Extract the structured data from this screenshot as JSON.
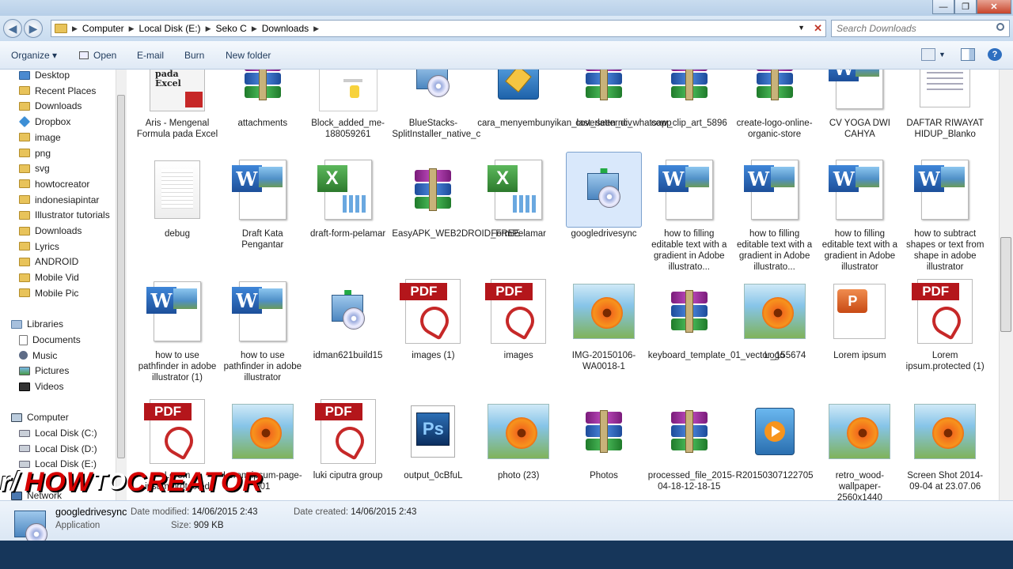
{
  "window": {
    "minimize": "—",
    "maximize": "❐",
    "close": "✕"
  },
  "address": {
    "crumbs": [
      "Computer",
      "Local Disk (E:)",
      "Seko C",
      "Downloads"
    ],
    "search_placeholder": "Search Downloads"
  },
  "toolbar": {
    "organize": "Organize ▾",
    "open": "Open",
    "email": "E-mail",
    "burn": "Burn",
    "new_folder": "New folder"
  },
  "sidebar": {
    "items": [
      "Desktop",
      "Recent Places",
      "Downloads",
      "Dropbox",
      "image",
      "png",
      "svg",
      "howtocreator",
      "indonesiapintar",
      "Illustrator tutorials",
      "Downloads",
      "Lyrics",
      "ANDROID",
      "Mobile Vid",
      "Mobile Pic"
    ],
    "libraries": "Libraries",
    "library_items": [
      "Documents",
      "Music",
      "Pictures",
      "Videos"
    ],
    "computer": "Computer",
    "drives": [
      "Local Disk (C:)",
      "Local Disk (D:)",
      "Local Disk (E:)"
    ],
    "network": "Network"
  },
  "files": [
    {
      "name": "Aris - Mengenal Formula pada Excel",
      "icon": "book-pdf-thumbnail",
      "thumb_text": "Mengenal Formula pada Excel"
    },
    {
      "name": "attachments",
      "icon": "winrar-archive"
    },
    {
      "name": "Block_added_me-188059261",
      "icon": "image-thumbnail"
    },
    {
      "name": "BlueStacks-SplitInstaller_native_c",
      "icon": "setup-installer"
    },
    {
      "name": "cara_menyembunyikan_last_seen_di_whatsapp",
      "icon": "plugin-file"
    },
    {
      "name": "coverlatterncv",
      "icon": "winrar-archive"
    },
    {
      "name": "cow_clip_art_5896",
      "icon": "winrar-archive"
    },
    {
      "name": "create-logo-online-organic-store",
      "icon": "winrar-archive"
    },
    {
      "name": "CV YOGA DWI CAHYA",
      "icon": "word-document"
    },
    {
      "name": "DAFTAR RIWAYAT HIDUP_Blanko",
      "icon": "document-list"
    },
    {
      "name": "debug",
      "icon": "blank-text-file"
    },
    {
      "name": "Draft Kata Pengantar",
      "icon": "word-document"
    },
    {
      "name": "draft-form-pelamar",
      "icon": "excel-spreadsheet"
    },
    {
      "name": "EasyAPK_WEB2DROID_FREE",
      "icon": "winrar-archive"
    },
    {
      "name": "FormPelamar",
      "icon": "excel-spreadsheet"
    },
    {
      "name": "googledrivesync",
      "icon": "setup-installer",
      "selected": true
    },
    {
      "name": "how to filling editable text with a gradient in Adobe illustrato...",
      "icon": "word-document"
    },
    {
      "name": "how to filling editable text with a gradient in Adobe illustrato...",
      "icon": "word-document"
    },
    {
      "name": "how to filling editable text with a gradient in Adobe illustrator",
      "icon": "word-document"
    },
    {
      "name": "how to subtract shapes or text from shape in adobe illustrator",
      "icon": "word-document"
    },
    {
      "name": "how to use pathfinder in adobe illustrator (1)",
      "icon": "word-document"
    },
    {
      "name": "how to use pathfinder in adobe illustrator",
      "icon": "word-document"
    },
    {
      "name": "idman621build15",
      "icon": "setup-installer"
    },
    {
      "name": "images (1)",
      "icon": "pdf-document"
    },
    {
      "name": "images",
      "icon": "pdf-document"
    },
    {
      "name": "IMG-20150106-WA0018-1",
      "icon": "flower-image"
    },
    {
      "name": "keyboard_template_01_vector_155674",
      "icon": "winrar-archive"
    },
    {
      "name": "Logo",
      "icon": "flower-image"
    },
    {
      "name": "Lorem ipsum",
      "icon": "powerpoint-document"
    },
    {
      "name": "Lorem ipsum.protected (1)",
      "icon": "pdf-document"
    },
    {
      "name": "Lorem ipsum.protected",
      "icon": "pdf-document"
    },
    {
      "name": "Lorem ipsum-page-001",
      "icon": "flower-image"
    },
    {
      "name": "luki ciputra group",
      "icon": "pdf-document"
    },
    {
      "name": "output_0cBfuL",
      "icon": "photoshop-file"
    },
    {
      "name": "photo (23)",
      "icon": "flower-image"
    },
    {
      "name": "Photos",
      "icon": "winrar-archive"
    },
    {
      "name": "processed_file_2015-04-18-12-18-15",
      "icon": "winrar-archive"
    },
    {
      "name": "R20150307122705",
      "icon": "media-player-file"
    },
    {
      "name": "retro_wood-wallpaper-2560x1440",
      "icon": "flower-image"
    },
    {
      "name": "Screen Shot 2014-09-04 at 23.07.06",
      "icon": "flower-image"
    }
  ],
  "details": {
    "name": "googledrivesync",
    "type": "Application",
    "modified_label": "Date modified:",
    "modified": "14/06/2015 2:43",
    "size_label": "Size:",
    "size": "909 KB",
    "created_label": "Date created:",
    "created": "14/06/2015 2:43"
  },
  "watermark": {
    "prefix": "r/",
    "how": "HOW",
    "to": "TO",
    "creator": "CREATOR"
  }
}
